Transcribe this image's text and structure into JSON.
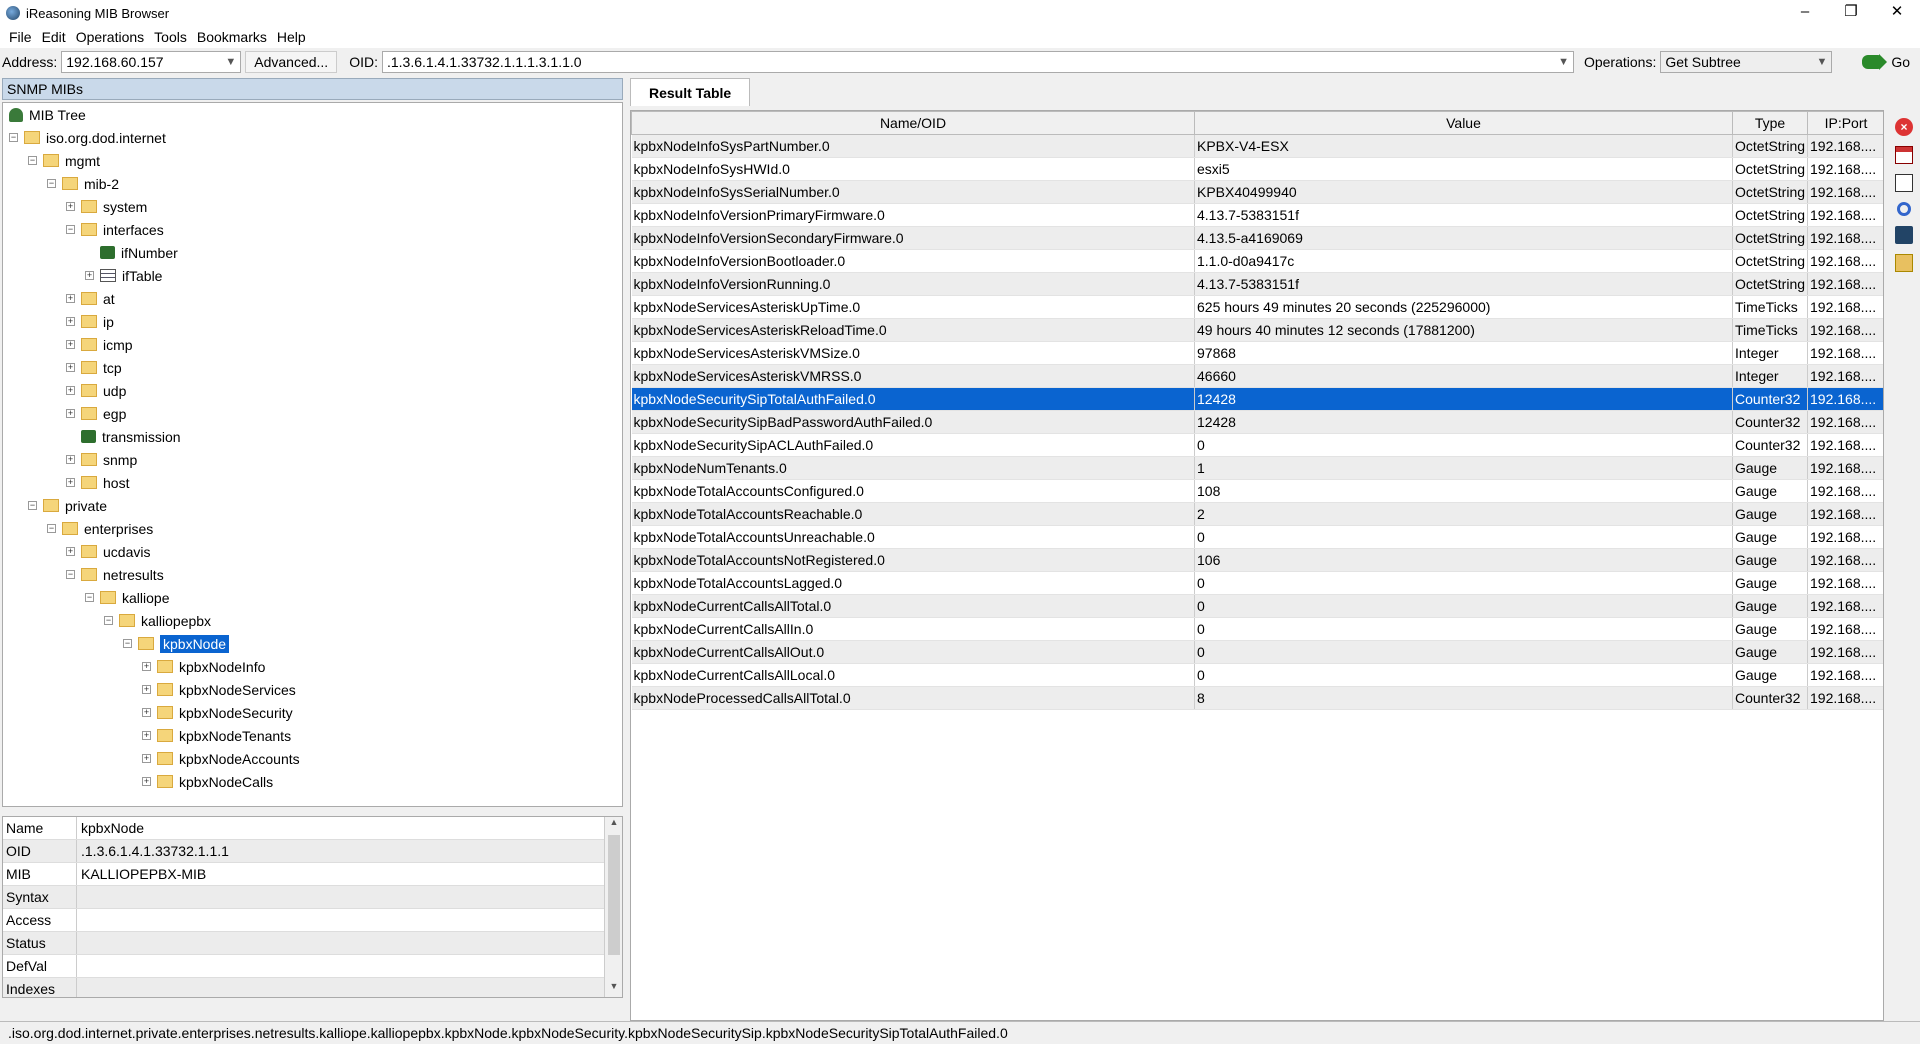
{
  "window": {
    "title": "iReasoning MIB Browser",
    "minimize": "–",
    "maximize": "❐",
    "close": "✕"
  },
  "menu": [
    "File",
    "Edit",
    "Operations",
    "Tools",
    "Bookmarks",
    "Help"
  ],
  "toolbar": {
    "address_label": "Address:",
    "address_value": "192.168.60.157",
    "advanced_label": "Advanced...",
    "oid_label": "OID:",
    "oid_value": ".1.3.6.1.4.1.33732.1.1.1.3.1.1.0",
    "operations_label": "Operations:",
    "operations_value": "Get Subtree",
    "go_label": "Go"
  },
  "left_panel": {
    "title": "SNMP MIBs"
  },
  "tree": [
    {
      "label": "MIB Tree",
      "depth": 0,
      "icon": "tree",
      "exp": ""
    },
    {
      "label": "iso.org.dod.internet",
      "depth": 0,
      "icon": "folder",
      "exp": "−"
    },
    {
      "label": "mgmt",
      "depth": 1,
      "icon": "folder",
      "exp": "−"
    },
    {
      "label": "mib-2",
      "depth": 2,
      "icon": "folder",
      "exp": "−"
    },
    {
      "label": "system",
      "depth": 3,
      "icon": "folder",
      "exp": "+"
    },
    {
      "label": "interfaces",
      "depth": 3,
      "icon": "folder",
      "exp": "−"
    },
    {
      "label": "ifNumber",
      "depth": 4,
      "icon": "leaf",
      "exp": ""
    },
    {
      "label": "ifTable",
      "depth": 4,
      "icon": "table",
      "exp": "+"
    },
    {
      "label": "at",
      "depth": 3,
      "icon": "folder",
      "exp": "+"
    },
    {
      "label": "ip",
      "depth": 3,
      "icon": "folder",
      "exp": "+"
    },
    {
      "label": "icmp",
      "depth": 3,
      "icon": "folder",
      "exp": "+"
    },
    {
      "label": "tcp",
      "depth": 3,
      "icon": "folder",
      "exp": "+"
    },
    {
      "label": "udp",
      "depth": 3,
      "icon": "folder",
      "exp": "+"
    },
    {
      "label": "egp",
      "depth": 3,
      "icon": "folder",
      "exp": "+"
    },
    {
      "label": "transmission",
      "depth": 3,
      "icon": "leaf",
      "exp": ""
    },
    {
      "label": "snmp",
      "depth": 3,
      "icon": "folder",
      "exp": "+"
    },
    {
      "label": "host",
      "depth": 3,
      "icon": "folder",
      "exp": "+"
    },
    {
      "label": "private",
      "depth": 1,
      "icon": "folder",
      "exp": "−"
    },
    {
      "label": "enterprises",
      "depth": 2,
      "icon": "folder",
      "exp": "−"
    },
    {
      "label": "ucdavis",
      "depth": 3,
      "icon": "folder",
      "exp": "+"
    },
    {
      "label": "netresults",
      "depth": 3,
      "icon": "folder",
      "exp": "−"
    },
    {
      "label": "kalliope",
      "depth": 4,
      "icon": "folder",
      "exp": "−"
    },
    {
      "label": "kalliopepbx",
      "depth": 5,
      "icon": "folder",
      "exp": "−"
    },
    {
      "label": "kpbxNode",
      "depth": 6,
      "icon": "folder",
      "exp": "−",
      "selected": true
    },
    {
      "label": "kpbxNodeInfo",
      "depth": 7,
      "icon": "folder",
      "exp": "+"
    },
    {
      "label": "kpbxNodeServices",
      "depth": 7,
      "icon": "folder",
      "exp": "+"
    },
    {
      "label": "kpbxNodeSecurity",
      "depth": 7,
      "icon": "folder",
      "exp": "+"
    },
    {
      "label": "kpbxNodeTenants",
      "depth": 7,
      "icon": "folder",
      "exp": "+"
    },
    {
      "label": "kpbxNodeAccounts",
      "depth": 7,
      "icon": "folder",
      "exp": "+"
    },
    {
      "label": "kpbxNodeCalls",
      "depth": 7,
      "icon": "folder",
      "exp": "+"
    }
  ],
  "properties": [
    {
      "k": "Name",
      "v": "kpbxNode"
    },
    {
      "k": "OID",
      "v": ".1.3.6.1.4.1.33732.1.1.1"
    },
    {
      "k": "MIB",
      "v": "KALLIOPEPBX-MIB"
    },
    {
      "k": "Syntax",
      "v": ""
    },
    {
      "k": "Access",
      "v": ""
    },
    {
      "k": "Status",
      "v": ""
    },
    {
      "k": "DefVal",
      "v": ""
    },
    {
      "k": "Indexes",
      "v": ""
    }
  ],
  "result_tab": "Result Table",
  "columns": [
    "Name/OID",
    "Value",
    "Type",
    "IP:Port"
  ],
  "rows": [
    [
      "kpbxNodeInfoSysPartNumber.0",
      "KPBX-V4-ESX",
      "OctetString",
      "192.168...."
    ],
    [
      "kpbxNodeInfoSysHWId.0",
      "esxi5",
      "OctetString",
      "192.168...."
    ],
    [
      "kpbxNodeInfoSysSerialNumber.0",
      "KPBX40499940",
      "OctetString",
      "192.168...."
    ],
    [
      "kpbxNodeInfoVersionPrimaryFirmware.0",
      "4.13.7-5383151f",
      "OctetString",
      "192.168...."
    ],
    [
      "kpbxNodeInfoVersionSecondaryFirmware.0",
      "4.13.5-a4169069",
      "OctetString",
      "192.168...."
    ],
    [
      "kpbxNodeInfoVersionBootloader.0",
      "1.1.0-d0a9417c",
      "OctetString",
      "192.168...."
    ],
    [
      "kpbxNodeInfoVersionRunning.0",
      "4.13.7-5383151f",
      "OctetString",
      "192.168...."
    ],
    [
      "kpbxNodeServicesAsteriskUpTime.0",
      "625 hours 49 minutes 20 seconds (225296000)",
      "TimeTicks",
      "192.168...."
    ],
    [
      "kpbxNodeServicesAsteriskReloadTime.0",
      "49 hours 40 minutes 12 seconds (17881200)",
      "TimeTicks",
      "192.168...."
    ],
    [
      "kpbxNodeServicesAsteriskVMSize.0",
      "97868",
      "Integer",
      "192.168...."
    ],
    [
      "kpbxNodeServicesAsteriskVMRSS.0",
      "46660",
      "Integer",
      "192.168...."
    ],
    [
      "kpbxNodeSecuritySipTotalAuthFailed.0",
      "12428",
      "Counter32",
      "192.168...."
    ],
    [
      "kpbxNodeSecuritySipBadPasswordAuthFailed.0",
      "12428",
      "Counter32",
      "192.168...."
    ],
    [
      "kpbxNodeSecuritySipACLAuthFailed.0",
      "0",
      "Counter32",
      "192.168...."
    ],
    [
      "kpbxNodeNumTenants.0",
      "1",
      "Gauge",
      "192.168...."
    ],
    [
      "kpbxNodeTotalAccountsConfigured.0",
      "108",
      "Gauge",
      "192.168...."
    ],
    [
      "kpbxNodeTotalAccountsReachable.0",
      "2",
      "Gauge",
      "192.168...."
    ],
    [
      "kpbxNodeTotalAccountsUnreachable.0",
      "0",
      "Gauge",
      "192.168...."
    ],
    [
      "kpbxNodeTotalAccountsNotRegistered.0",
      "106",
      "Gauge",
      "192.168...."
    ],
    [
      "kpbxNodeTotalAccountsLagged.0",
      "0",
      "Gauge",
      "192.168...."
    ],
    [
      "kpbxNodeCurrentCallsAllTotal.0",
      "0",
      "Gauge",
      "192.168...."
    ],
    [
      "kpbxNodeCurrentCallsAllIn.0",
      "0",
      "Gauge",
      "192.168...."
    ],
    [
      "kpbxNodeCurrentCallsAllOut.0",
      "0",
      "Gauge",
      "192.168...."
    ],
    [
      "kpbxNodeCurrentCallsAllLocal.0",
      "0",
      "Gauge",
      "192.168...."
    ],
    [
      "kpbxNodeProcessedCallsAllTotal.0",
      "8",
      "Counter32",
      "192.168...."
    ]
  ],
  "selected_row": 11,
  "statusbar": ".iso.org.dod.internet.private.enterprises.netresults.kalliope.kalliopepbx.kpbxNode.kpbxNodeSecurity.kpbxNodeSecuritySip.kpbxNodeSecuritySipTotalAuthFailed.0"
}
